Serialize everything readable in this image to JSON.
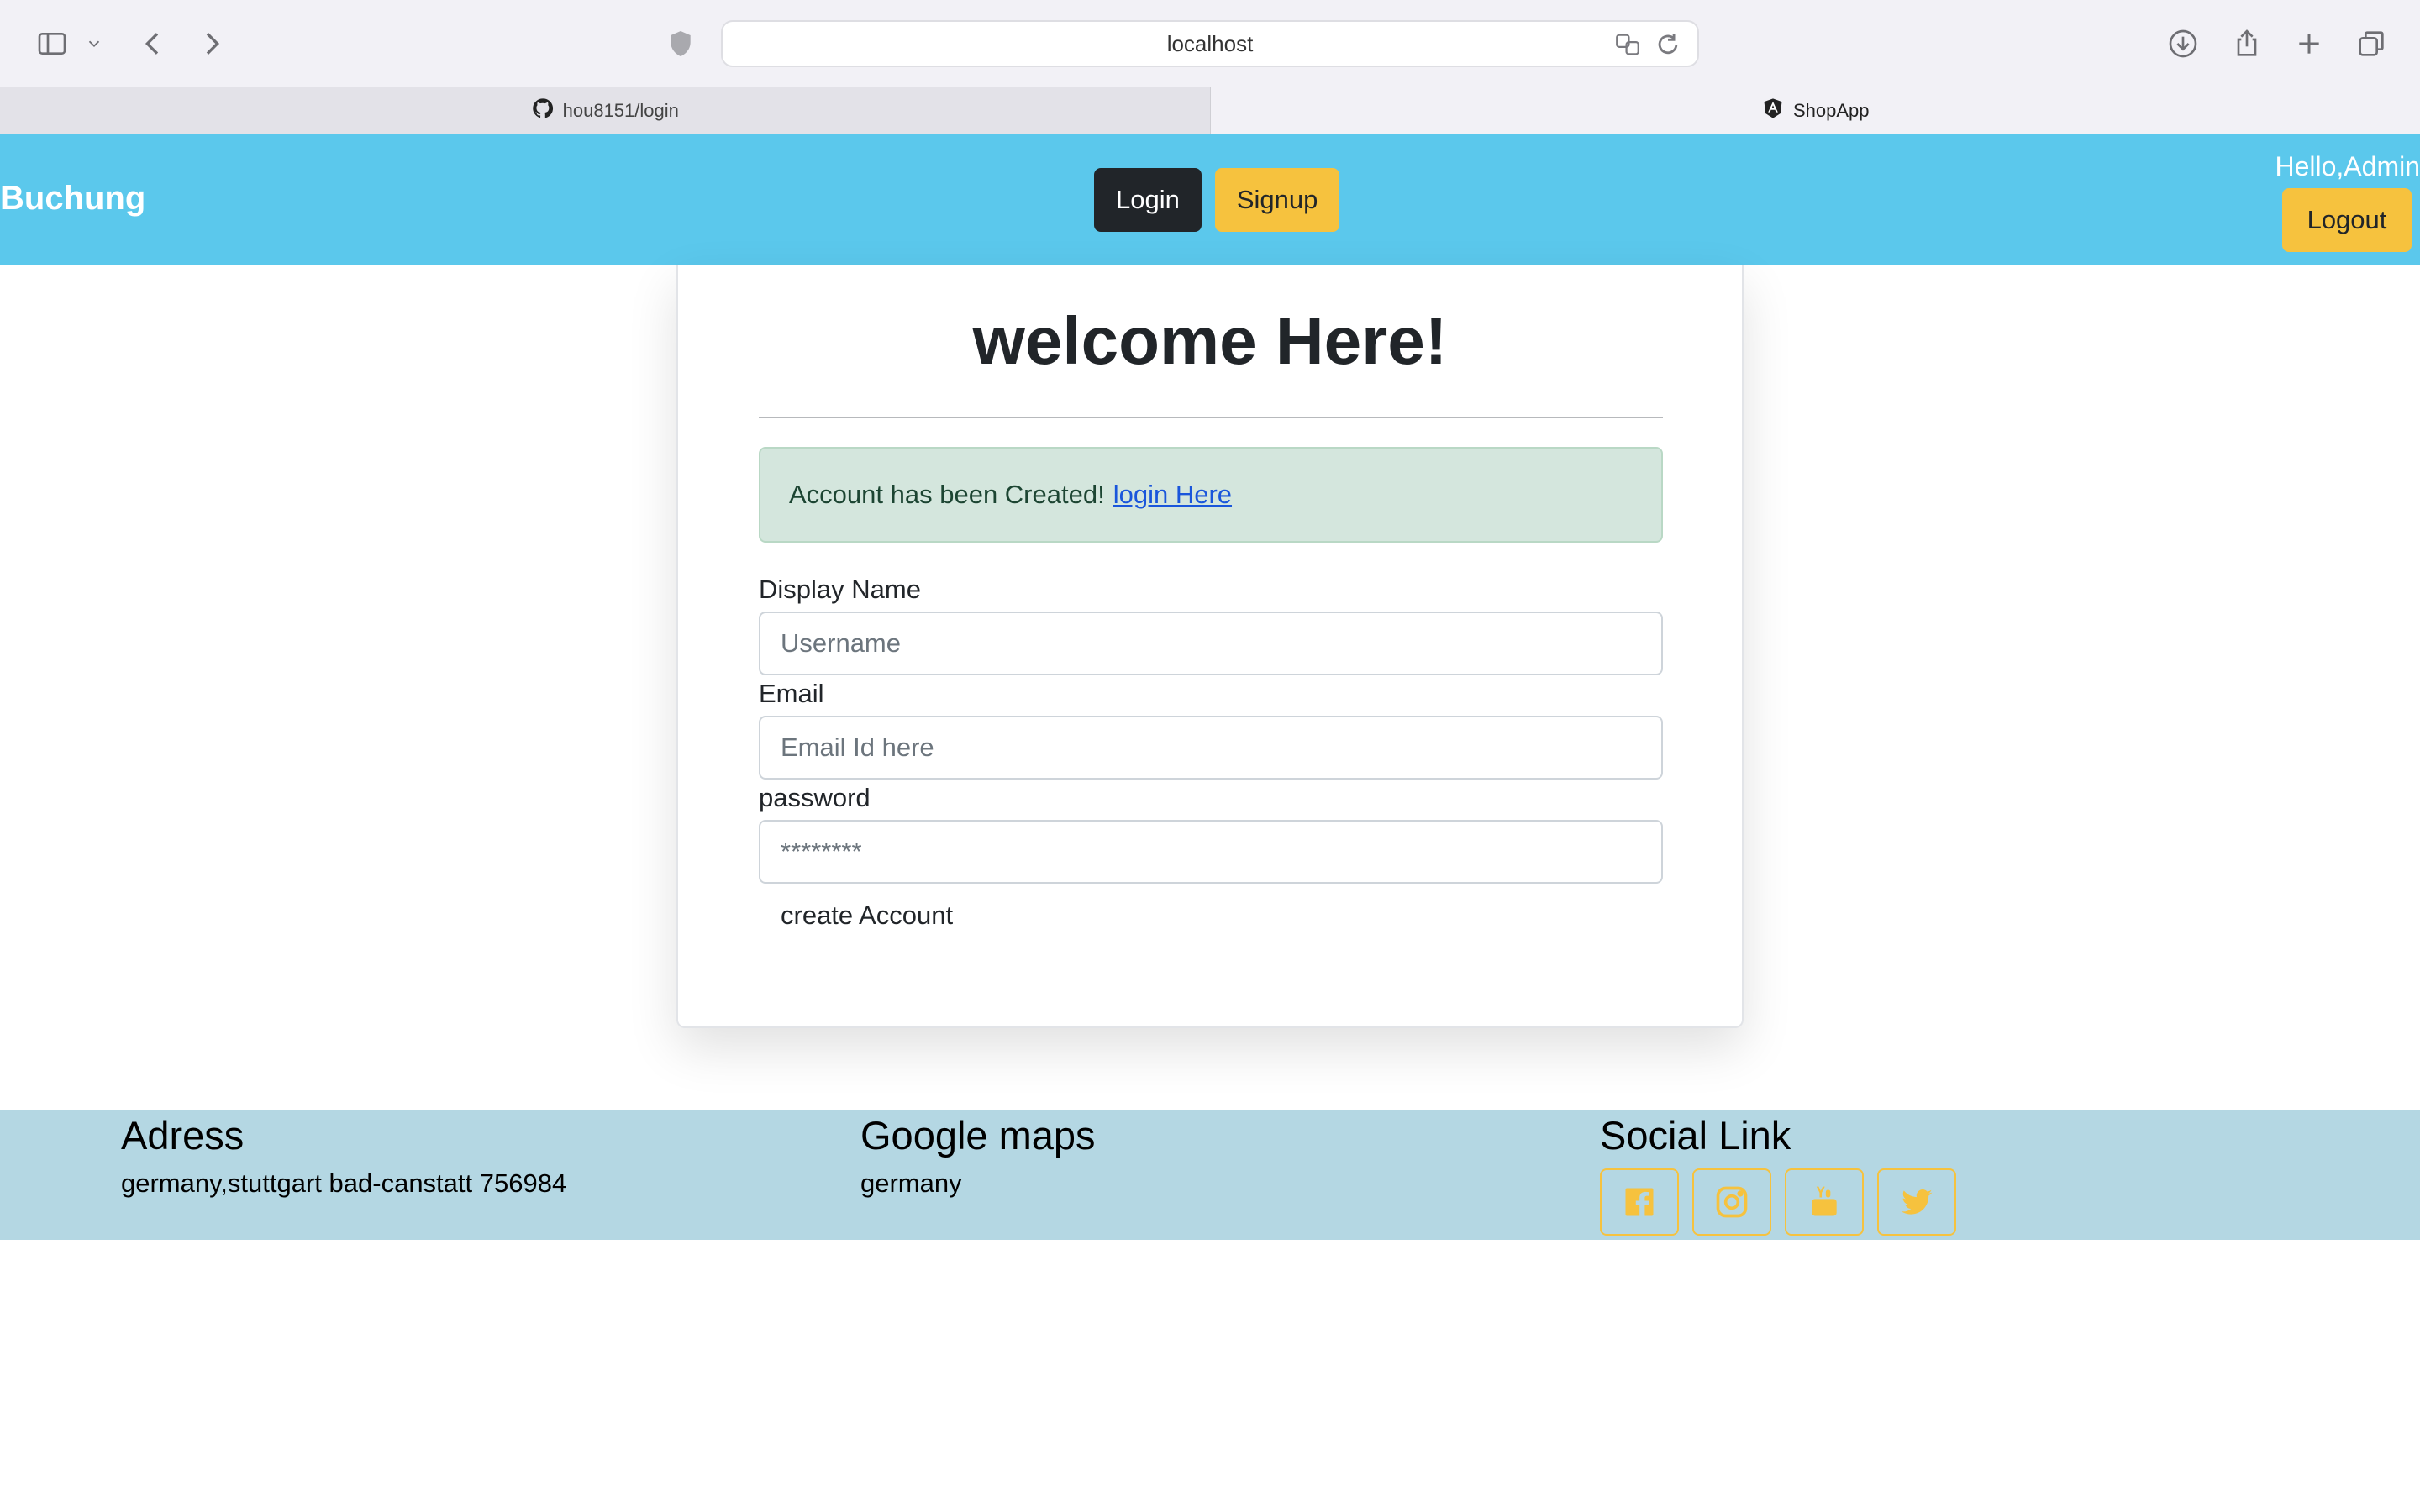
{
  "browser": {
    "address": "localhost",
    "tabs": [
      {
        "title": "hou8151/login",
        "icon": "github-icon"
      },
      {
        "title": "ShopApp",
        "icon": "angular-icon"
      }
    ]
  },
  "navbar": {
    "brand": "Buchung",
    "login_label": "Login",
    "signup_label": "Signup",
    "greeting": "Hello,Admin",
    "logout_label": "Logout",
    "colors": {
      "bar": "#5bc8ec",
      "dark_button": "#212529",
      "warning_button": "#f6c23e"
    }
  },
  "card": {
    "title": "welcome Here!",
    "alert": {
      "text": "Account has been Created!",
      "link": "login Here"
    },
    "fields": {
      "display_name": {
        "label": "Display Name",
        "placeholder": "Username"
      },
      "email": {
        "label": "Email",
        "placeholder": "Email Id here"
      },
      "password": {
        "label": "password",
        "placeholder": "********"
      }
    },
    "submit_label": "create Account"
  },
  "footer": {
    "address": {
      "heading": "Adress",
      "text": "germany,stuttgart bad-canstatt 756984"
    },
    "maps": {
      "heading": "Google maps",
      "text": "germany"
    },
    "social": {
      "heading": "Social Link",
      "icons": [
        "facebook-icon",
        "instagram-icon",
        "youtube-icon",
        "twitter-icon"
      ]
    }
  }
}
